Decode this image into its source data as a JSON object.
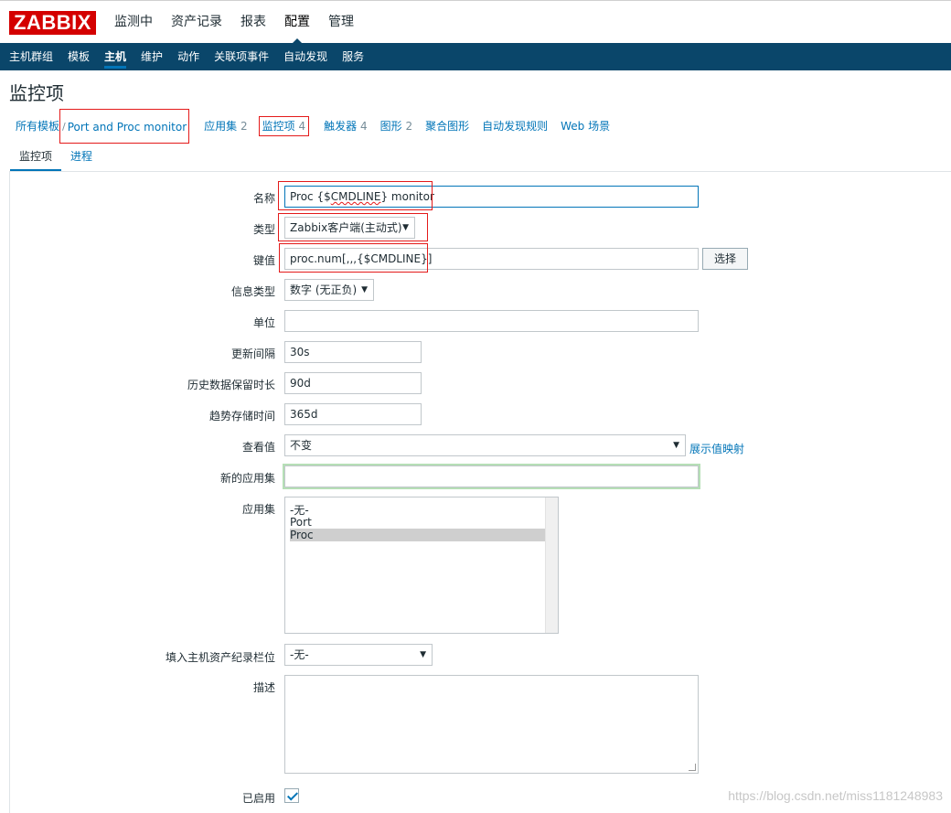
{
  "header": {
    "logo": "ZABBIX",
    "nav": [
      "监测中",
      "资产记录",
      "报表",
      "配置",
      "管理"
    ],
    "selected_index": 3
  },
  "subnav": {
    "items": [
      "主机群组",
      "模板",
      "主机",
      "维护",
      "动作",
      "关联项事件",
      "自动发现",
      "服务"
    ],
    "selected_index": 2
  },
  "page": {
    "title": "监控项"
  },
  "breadcrumb": {
    "all_templates": "所有模板",
    "separator": "/",
    "host": "Port and Proc monitor",
    "applications": {
      "label": "应用集",
      "count": "2"
    },
    "items": {
      "label": "监控项",
      "count": "4"
    },
    "triggers": {
      "label": "触发器",
      "count": "4"
    },
    "graphs": {
      "label": "图形",
      "count": "2"
    },
    "screens": "聚合图形",
    "discovery": "自动发现规则",
    "web": "Web 场景"
  },
  "form_tabs": {
    "item": "监控项",
    "process": "进程"
  },
  "form": {
    "name": {
      "label": "名称",
      "value_prefix": "Proc {$",
      "value_underlined": "CMDLINE",
      "value_suffix": "} monitor"
    },
    "type": {
      "label": "类型",
      "value": "Zabbix客户端(主动式)"
    },
    "key": {
      "label": "键值",
      "value": "proc.num[,,,{$CMDLINE}]",
      "select_button": "选择"
    },
    "info_type": {
      "label": "信息类型",
      "value": "数字 (无正负)"
    },
    "units": {
      "label": "单位",
      "value": ""
    },
    "interval": {
      "label": "更新间隔",
      "value": "30s"
    },
    "history": {
      "label": "历史数据保留时长",
      "value": "90d"
    },
    "trends": {
      "label": "趋势存储时间",
      "value": "365d"
    },
    "show_value": {
      "label": "查看值",
      "value": "不变",
      "link": "展示值映射"
    },
    "new_application": {
      "label": "新的应用集",
      "value": ""
    },
    "applications": {
      "label": "应用集",
      "options": [
        "-无-",
        "Port",
        "Proc"
      ],
      "selected": "Proc"
    },
    "inventory": {
      "label": "填入主机资产纪录栏位",
      "value": "-无-"
    },
    "description": {
      "label": "描述",
      "value": ""
    },
    "enabled": {
      "label": "已启用",
      "checked": true
    }
  },
  "watermark": "https://blog.csdn.net/miss1181248983",
  "colors": {
    "brand": "#d40000",
    "nav_bg": "#0a466a",
    "link": "#0275b8",
    "highlight_box": "#e41a1a"
  }
}
